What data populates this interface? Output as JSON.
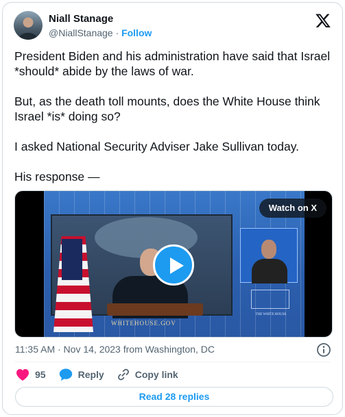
{
  "author": {
    "display_name": "Niall Stanage",
    "handle": "@NiallStanage",
    "separator": "·",
    "follow_label": "Follow"
  },
  "tweet": {
    "paragraphs": [
      "President Biden and his administration have said that Israel *should* abide by the laws of war.",
      "But, as the death toll mounts, does the White House think Israel *is* doing so?",
      "I asked National Security Adviser Jake Sullivan today.",
      "His response —"
    ]
  },
  "media": {
    "watch_label": "Watch on X",
    "lower_text": "WHITEHOUSE.GOV",
    "seal_text": "THE WHITE HOUSE"
  },
  "meta": {
    "timestamp": "11:35 AM · Nov 14, 2023 from Washington, DC"
  },
  "actions": {
    "likes": "95",
    "reply_label": "Reply",
    "copy_link_label": "Copy link"
  },
  "footer": {
    "read_replies_label": "Read 28 replies"
  },
  "colors": {
    "accent": "#1d9bf0",
    "like": "#f91880",
    "secondary_text": "#536471"
  }
}
